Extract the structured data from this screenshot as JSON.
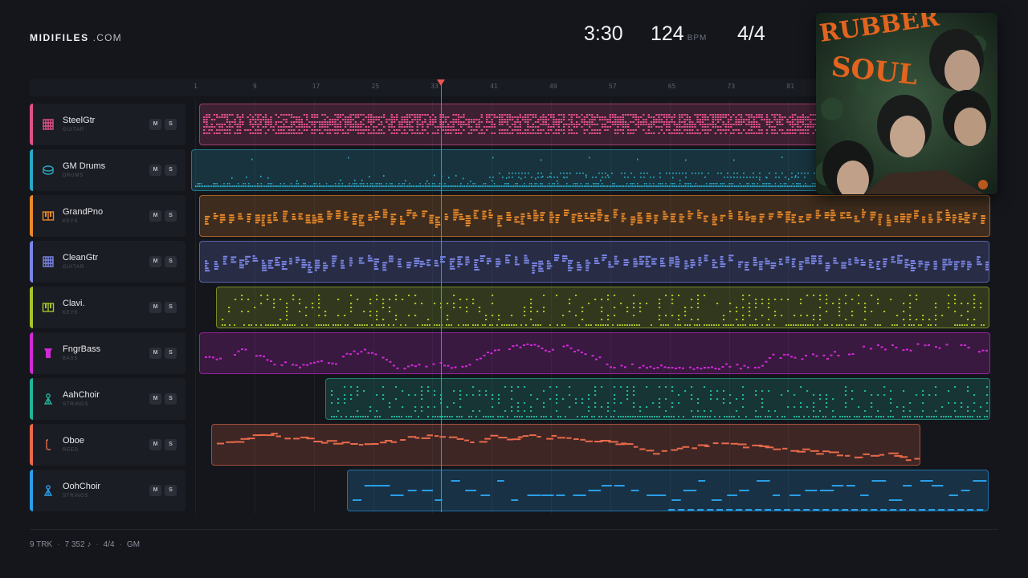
{
  "brand": {
    "name": "MIDIFILES",
    "suffix": ".COM"
  },
  "stats": {
    "duration": "3:30",
    "tempo": "124",
    "tempo_unit": "BPM",
    "time_signature": "4/4"
  },
  "cover": {
    "title_art": "RUBBER SOUL"
  },
  "ruler": {
    "ticks": [
      "1",
      "9",
      "17",
      "25",
      "33",
      "41",
      "49",
      "57",
      "65",
      "73",
      "81"
    ]
  },
  "playhead": {
    "bar": 34.2
  },
  "tracks": [
    {
      "name": "SteelGtr",
      "category": "GUITAR",
      "color": "#e0508c",
      "icon": "guitar-icon",
      "start": 1.5,
      "end": 110,
      "pattern": "dense"
    },
    {
      "name": "GM Drums",
      "category": "DRUMS",
      "color": "#2aa8c4",
      "icon": "drum-icon",
      "start": 0.5,
      "end": 110,
      "pattern": "drums"
    },
    {
      "name": "GrandPno",
      "category": "KEYS",
      "color": "#e8892a",
      "icon": "piano-icon",
      "start": 1.5,
      "end": 108.5,
      "pattern": "chords"
    },
    {
      "name": "CleanGtr",
      "category": "GUITAR",
      "color": "#7a86e6",
      "icon": "guitar-icon",
      "start": 1.5,
      "end": 108.2,
      "pattern": "chords"
    },
    {
      "name": "Clavi.",
      "category": "KEYS",
      "color": "#a8c22a",
      "icon": "piano-icon",
      "start": 3.8,
      "end": 108.2,
      "pattern": "sparse"
    },
    {
      "name": "FngrBass",
      "category": "BASS",
      "color": "#d02ad6",
      "icon": "bass-icon",
      "start": 1.5,
      "end": 108.5,
      "pattern": "bass"
    },
    {
      "name": "AahChoir",
      "category": "STRINGS",
      "color": "#22b49a",
      "icon": "choir-icon",
      "start": 18.5,
      "end": 108.5,
      "pattern": "sparse"
    },
    {
      "name": "Oboe",
      "category": "REED",
      "color": "#e86a4a",
      "icon": "oboe-icon",
      "start": 3.2,
      "end": 98.8,
      "pattern": "melody"
    },
    {
      "name": "OohChoir",
      "category": "STRINGS",
      "color": "#2a9ee8",
      "icon": "choir-icon",
      "start": 21.5,
      "end": 108,
      "pattern": "long"
    }
  ],
  "footer": {
    "tracks": "9 TRK",
    "notes": "7 352 ♪",
    "time_signature": "4/4",
    "standard": "GM"
  }
}
